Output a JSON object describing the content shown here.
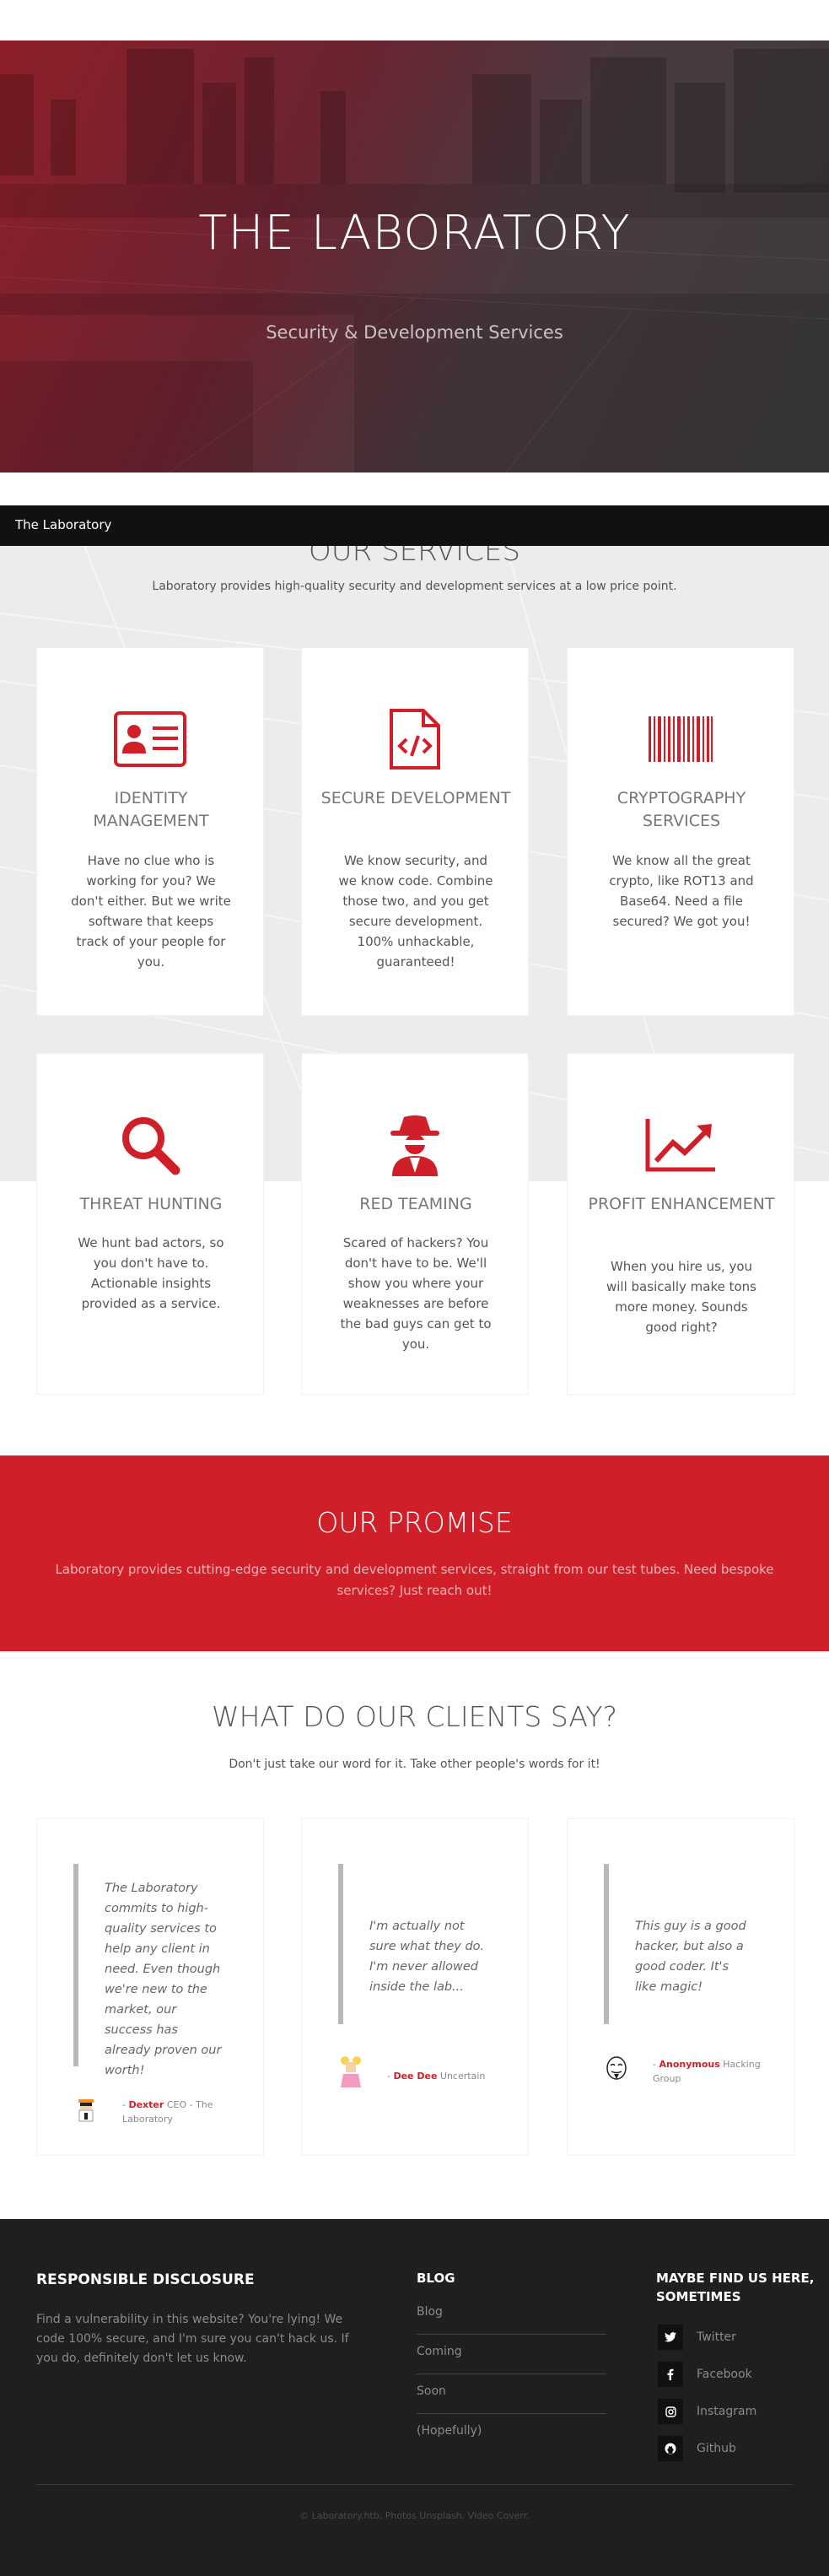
{
  "hero": {
    "title": "THE LABORATORY",
    "subtitle": "Security & Development Services"
  },
  "navbar": {
    "brand": "The Laboratory"
  },
  "services": {
    "title": "OUR SERVICES",
    "subtitle": "Laboratory provides high-quality security and development services at a low price point.",
    "items": [
      {
        "icon": "id-card-icon",
        "title": "IDENTITY MANAGEMENT",
        "text": "Have no clue who is working for you? We don't either. But we write software that keeps track of your people for you."
      },
      {
        "icon": "code-file-icon",
        "title": "SECURE DEVELOPMENT",
        "text": "We know security, and we know code. Combine those two, and you get secure development. 100% unhackable, guaranteed!"
      },
      {
        "icon": "barcode-icon",
        "title": "CRYPTOGRAPHY SERVICES",
        "text": "We know all the great crypto, like ROT13 and Base64. Need a file secured? We got you!"
      },
      {
        "icon": "search-icon",
        "title": "THREAT HUNTING",
        "text": "We hunt bad actors, so you don't have to. Actionable insights provided as a service."
      },
      {
        "icon": "spy-icon",
        "title": "RED TEAMING",
        "text": "Scared of hackers? You don't have to be. We'll show you where your weaknesses are before the bad guys can get to you."
      },
      {
        "icon": "chart-line-icon",
        "title": "PROFIT ENHANCEMENT",
        "text": "When you hire us, you will basically make tons more money. Sounds good right?"
      }
    ]
  },
  "promise": {
    "title": "OUR PROMISE",
    "text": "Laboratory provides cutting-edge security and development services, straight from our test tubes. Need bespoke services? Just reach out!"
  },
  "clients": {
    "title": "WHAT DO OUR CLIENTS SAY?",
    "subtitle": "Don't just take our word for it. Take other people's words for it!",
    "testimonials": [
      {
        "quote": "The Laboratory commits to high-quality services to help any client in need. Even though we're new to the market, our success has already proven our worth!",
        "dash": "- ",
        "name": "Dexter",
        "role": "CEO - The Laboratory"
      },
      {
        "quote": "I'm actually not sure what they do. I'm never allowed inside the lab...",
        "dash": "- ",
        "name": "Dee Dee",
        "role": "Uncertain"
      },
      {
        "quote": "This guy is a good hacker, but also a good coder. It's like magic!",
        "dash": "- ",
        "name": "Anonymous",
        "role": "Hacking Group"
      }
    ]
  },
  "footer": {
    "disclosure_title": "RESPONSIBLE DISCLOSURE",
    "disclosure_text": "Find a vulnerability in this website? You're lying! We code 100% secure, and I'm sure you can't hack us. If you do, definitely don't let us know.",
    "blog_title": "BLOG",
    "blog_links": [
      "Blog",
      "Coming",
      "Soon",
      "(Hopefully)"
    ],
    "social_title": "MAYBE FIND US HERE, SOMETIMES",
    "social": [
      {
        "icon": "twitter-icon",
        "label": "Twitter"
      },
      {
        "icon": "facebook-icon",
        "label": "Facebook"
      },
      {
        "icon": "instagram-icon",
        "label": "Instagram"
      },
      {
        "icon": "github-icon",
        "label": "Github"
      }
    ],
    "copyright": "© Laboratory.htb. Photos Unsplash. Video Coverr."
  },
  "colors": {
    "accent": "#d01f29",
    "navbar": "#111111",
    "footer": "#1f1f1f"
  }
}
